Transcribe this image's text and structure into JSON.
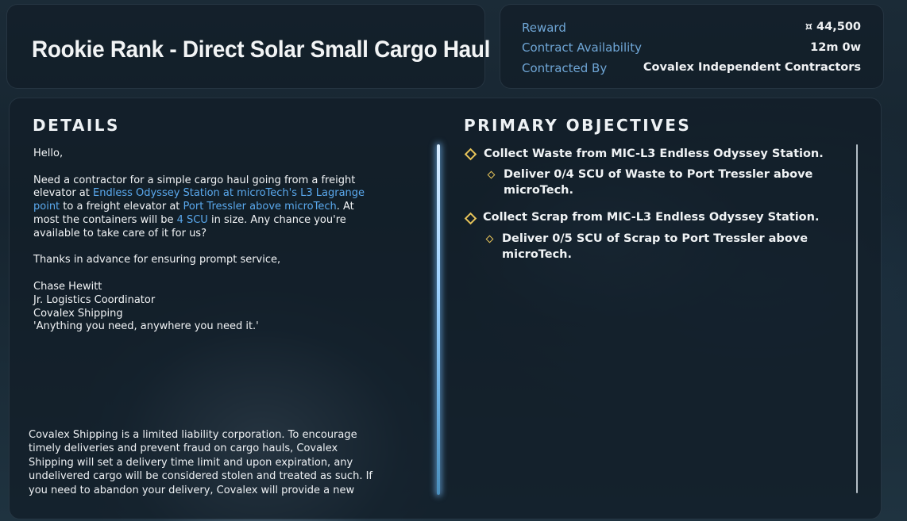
{
  "contract": {
    "title": "Rookie Rank - Direct Solar Small Cargo Haul"
  },
  "meta": {
    "reward_label": "Reward",
    "reward_value": "¤ 44,500",
    "availability_label": "Contract Availability",
    "availability_value": "12m 0w",
    "contracted_by_label": "Contracted By",
    "contracted_by_value": "Covalex Independent Contractors"
  },
  "details": {
    "heading": "DETAILS",
    "greeting": "Hello,",
    "para1_a": "Need a contractor for a simple cargo haul going from a freight elevator at ",
    "para1_link1": "Endless Odyssey Station at microTech's L3 Lagrange point",
    "para1_b": " to a freight elevator at ",
    "para1_link2": "Port Tressler above microTech",
    "para1_c": ". At most the containers will be ",
    "para1_link3": "4 SCU",
    "para1_d": " in size. Any chance you're available to take care of it for us?",
    "thanks": "Thanks in advance for ensuring prompt service,",
    "signature_name": "Chase Hewitt",
    "signature_title": "Jr. Logistics Coordinator",
    "signature_company": "Covalex Shipping",
    "signature_motto": "'Anything you need, anywhere you need it.'",
    "legal": "Covalex Shipping is a limited liability corporation. To encourage timely deliveries and prevent fraud on cargo hauls, Covalex Shipping will set a delivery time limit and upon expiration, any undelivered cargo will be considered stolen and treated as such. If you need to abandon your delivery, Covalex will provide a new drop"
  },
  "objectives": {
    "heading": "PRIMARY OBJECTIVES",
    "items": [
      {
        "text": "Collect Waste from MIC-L3 Endless Odyssey Station.",
        "sub": "Deliver 0/4 SCU of Waste to Port Tressler above microTech."
      },
      {
        "text": "Collect Scrap from MIC-L3 Endless Odyssey Station.",
        "sub": "Deliver 0/5 SCU of Scrap to Port Tressler above microTech."
      }
    ]
  },
  "colors": {
    "highlight": "#5aa9ee",
    "label": "#6fa6d6",
    "diamond": "#e7c45a"
  },
  "icons": {
    "objective_marker": "diamond-icon",
    "currency": "auec-symbol"
  }
}
